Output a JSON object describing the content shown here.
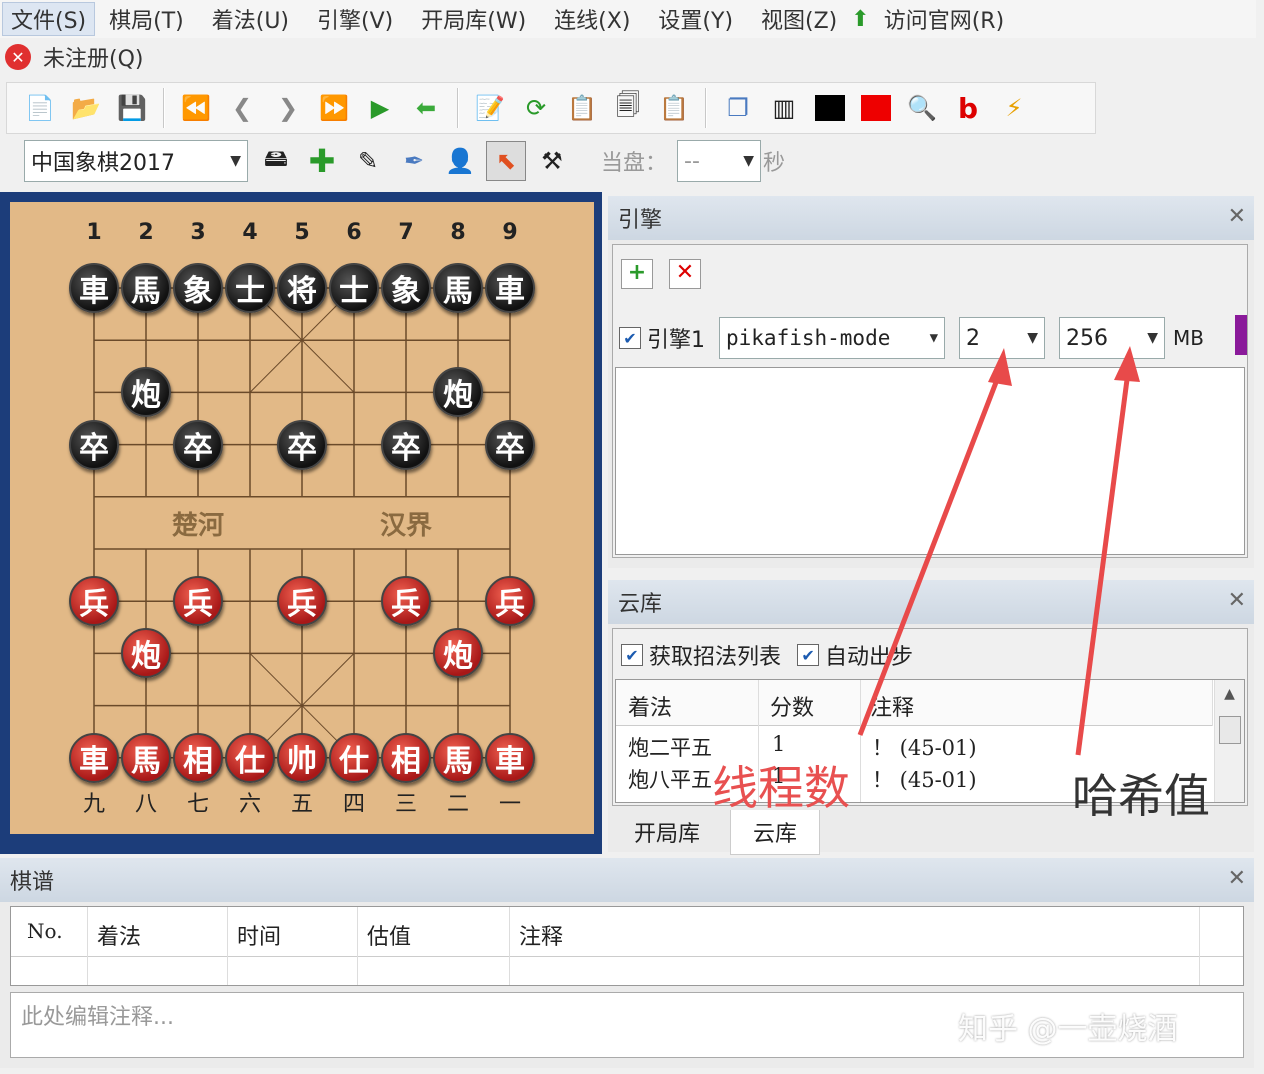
{
  "menu": [
    "文件(S)",
    "棋局(T)",
    "着法(U)",
    "引擎(V)",
    "开局库(W)",
    "连线(X)",
    "设置(Y)",
    "视图(Z)",
    "访问官网(R)"
  ],
  "unregistered": "未注册(Q)",
  "toolbar2": {
    "game_type": "中国象棋2017",
    "current_label": "当盘：",
    "time_value": "--",
    "seconds_unit": "秒"
  },
  "board": {
    "top_numbers": [
      "1",
      "2",
      "3",
      "4",
      "5",
      "6",
      "7",
      "8",
      "9"
    ],
    "bottom_numbers": [
      "九",
      "八",
      "七",
      "六",
      "五",
      "四",
      "三",
      "二",
      "一"
    ],
    "river_left": "楚河",
    "river_right": "汉界",
    "pieces": [
      {
        "c": "black",
        "t": "車",
        "col": 0,
        "row": 0
      },
      {
        "c": "black",
        "t": "馬",
        "col": 1,
        "row": 0
      },
      {
        "c": "black",
        "t": "象",
        "col": 2,
        "row": 0
      },
      {
        "c": "black",
        "t": "士",
        "col": 3,
        "row": 0
      },
      {
        "c": "black",
        "t": "将",
        "col": 4,
        "row": 0
      },
      {
        "c": "black",
        "t": "士",
        "col": 5,
        "row": 0
      },
      {
        "c": "black",
        "t": "象",
        "col": 6,
        "row": 0
      },
      {
        "c": "black",
        "t": "馬",
        "col": 7,
        "row": 0
      },
      {
        "c": "black",
        "t": "車",
        "col": 8,
        "row": 0
      },
      {
        "c": "black",
        "t": "炮",
        "col": 1,
        "row": 2
      },
      {
        "c": "black",
        "t": "炮",
        "col": 7,
        "row": 2
      },
      {
        "c": "black",
        "t": "卒",
        "col": 0,
        "row": 3
      },
      {
        "c": "black",
        "t": "卒",
        "col": 2,
        "row": 3
      },
      {
        "c": "black",
        "t": "卒",
        "col": 4,
        "row": 3
      },
      {
        "c": "black",
        "t": "卒",
        "col": 6,
        "row": 3
      },
      {
        "c": "black",
        "t": "卒",
        "col": 8,
        "row": 3
      },
      {
        "c": "red",
        "t": "兵",
        "col": 0,
        "row": 6
      },
      {
        "c": "red",
        "t": "兵",
        "col": 2,
        "row": 6
      },
      {
        "c": "red",
        "t": "兵",
        "col": 4,
        "row": 6
      },
      {
        "c": "red",
        "t": "兵",
        "col": 6,
        "row": 6
      },
      {
        "c": "red",
        "t": "兵",
        "col": 8,
        "row": 6
      },
      {
        "c": "red",
        "t": "炮",
        "col": 1,
        "row": 7
      },
      {
        "c": "red",
        "t": "炮",
        "col": 7,
        "row": 7
      },
      {
        "c": "red",
        "t": "車",
        "col": 0,
        "row": 9
      },
      {
        "c": "red",
        "t": "馬",
        "col": 1,
        "row": 9
      },
      {
        "c": "red",
        "t": "相",
        "col": 2,
        "row": 9
      },
      {
        "c": "red",
        "t": "仕",
        "col": 3,
        "row": 9
      },
      {
        "c": "red",
        "t": "帅",
        "col": 4,
        "row": 9
      },
      {
        "c": "red",
        "t": "仕",
        "col": 5,
        "row": 9
      },
      {
        "c": "red",
        "t": "相",
        "col": 6,
        "row": 9
      },
      {
        "c": "red",
        "t": "馬",
        "col": 7,
        "row": 9
      },
      {
        "c": "red",
        "t": "車",
        "col": 8,
        "row": 9
      }
    ]
  },
  "engine_panel": {
    "title": "引擎",
    "engine_label": "引擎1",
    "engine_name": "pikafish-mode",
    "threads": "2",
    "hash": "256",
    "hash_unit": "MB"
  },
  "cloud_panel": {
    "title": "云库",
    "fetch_moves": "获取招法列表",
    "auto_move": "自动出步",
    "headers": [
      "着法",
      "分数",
      "注释"
    ],
    "rows": [
      [
        "炮二平五",
        "1",
        "！ (45-01)"
      ],
      [
        "炮八平五",
        "1",
        "！ (45-01)"
      ]
    ],
    "tabs": [
      "开局库",
      "云库"
    ]
  },
  "record_panel": {
    "title": "棋谱",
    "headers": [
      "No.",
      "着法",
      "时间",
      "估值",
      "注释"
    ],
    "comment_placeholder": "此处编辑注释..."
  },
  "annotations": {
    "threads": "线程数",
    "hash": "哈希值"
  },
  "watermark": "知乎 @一壶烧酒"
}
